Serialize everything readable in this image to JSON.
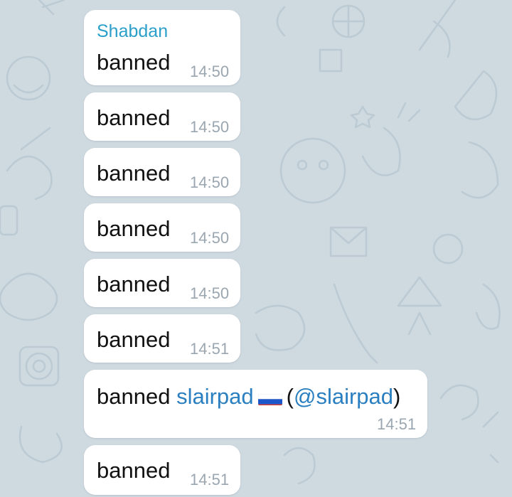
{
  "chat": {
    "first_message": {
      "sender": "Shabdan",
      "text": "banned",
      "time": "14:50"
    },
    "messages": [
      {
        "text": "banned",
        "time": "14:50"
      },
      {
        "text": "banned",
        "time": "14:50"
      },
      {
        "text": "banned",
        "time": "14:50"
      },
      {
        "text": "banned",
        "time": "14:50"
      },
      {
        "text": "banned",
        "time": "14:51"
      }
    ],
    "mention_message": {
      "prefix": "banned",
      "user_name": "slairpad",
      "flag": "russian-flag-icon",
      "open_paren": "(",
      "username": "@slairpad",
      "close_paren": ")",
      "time": "14:51"
    },
    "last_message": {
      "text": "banned",
      "time": "14:51"
    }
  },
  "colors": {
    "background": "#cfd9e0",
    "bubble": "#ffffff",
    "sender_name": "#2a9fc9",
    "link": "#2a7fc0",
    "timestamp": "#9aa6b0"
  }
}
